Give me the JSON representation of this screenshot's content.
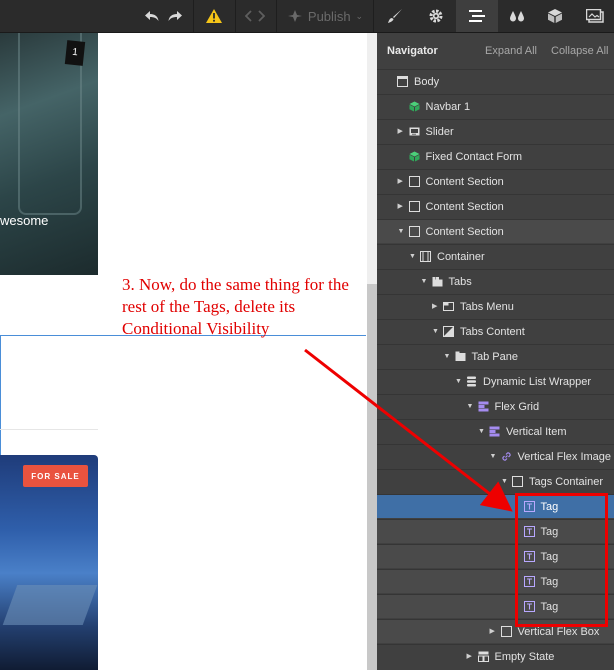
{
  "toolbar": {
    "publish_label": "Publish",
    "icons": [
      "undo-icon",
      "redo-icon",
      "warning-icon",
      "code-icon",
      "publish-icon",
      "brush-icon",
      "gear-icon",
      "navigator-icon",
      "drops-icon",
      "cube-icon",
      "assets-icon"
    ],
    "accent_warning": "#f5c518"
  },
  "canvas": {
    "hero_caption": "wesome",
    "sale_badge": "FOR SALE",
    "annotation": "3. Now, do the same thing for the rest of the Tags, delete its Conditional Visibility"
  },
  "navigator": {
    "title": "Navigator",
    "expand_all": "Expand All",
    "collapse_all": "Collapse All",
    "tree": [
      {
        "label": "Body",
        "icon": "body-icon",
        "depth": 0,
        "caret": ""
      },
      {
        "label": "Navbar 1",
        "icon": "symbol-icon",
        "depth": 1,
        "caret": ""
      },
      {
        "label": "Slider",
        "icon": "slider-icon",
        "depth": 1,
        "caret": "right"
      },
      {
        "label": "Fixed Contact Form",
        "icon": "symbol-icon",
        "depth": 1,
        "caret": ""
      },
      {
        "label": "Content Section",
        "icon": "section-icon",
        "depth": 1,
        "caret": "right"
      },
      {
        "label": "Content Section",
        "icon": "section-icon",
        "depth": 1,
        "caret": "right"
      },
      {
        "label": "Content Section",
        "icon": "section-icon",
        "depth": 1,
        "caret": "down"
      },
      {
        "label": "Container",
        "icon": "container-icon",
        "depth": 2,
        "caret": "down"
      },
      {
        "label": "Tabs",
        "icon": "tabs-icon",
        "depth": 3,
        "caret": "down"
      },
      {
        "label": "Tabs Menu",
        "icon": "tabs-menu-icon",
        "depth": 4,
        "caret": "right"
      },
      {
        "label": "Tabs Content",
        "icon": "tabs-content-icon",
        "depth": 4,
        "caret": "down"
      },
      {
        "label": "Tab Pane",
        "icon": "tab-pane-icon",
        "depth": 5,
        "caret": "down"
      },
      {
        "label": "Dynamic List Wrapper",
        "icon": "dynamic-list-icon",
        "depth": 6,
        "caret": "down"
      },
      {
        "label": "Flex Grid",
        "icon": "flex-grid-icon",
        "depth": 7,
        "caret": "down"
      },
      {
        "label": "Vertical Item",
        "icon": "dynamic-item-icon",
        "depth": 8,
        "caret": "down"
      },
      {
        "label": "Vertical Flex Image",
        "icon": "link-icon",
        "depth": 9,
        "caret": "down"
      },
      {
        "label": "Tags Container",
        "icon": "box-icon",
        "depth": 10,
        "caret": "down"
      },
      {
        "label": "Tag",
        "icon": "text-icon",
        "depth": 11,
        "caret": ""
      },
      {
        "label": "Tag",
        "icon": "text-icon",
        "depth": 11,
        "caret": ""
      },
      {
        "label": "Tag",
        "icon": "text-icon",
        "depth": 11,
        "caret": ""
      },
      {
        "label": "Tag",
        "icon": "text-icon",
        "depth": 11,
        "caret": ""
      },
      {
        "label": "Tag",
        "icon": "text-icon",
        "depth": 11,
        "caret": ""
      },
      {
        "label": "Vertical Flex Box",
        "icon": "box-icon",
        "depth": 9,
        "caret": "right"
      },
      {
        "label": "Empty State",
        "icon": "empty-state-icon",
        "depth": 7,
        "caret": "right"
      }
    ],
    "selected_index": 17
  }
}
